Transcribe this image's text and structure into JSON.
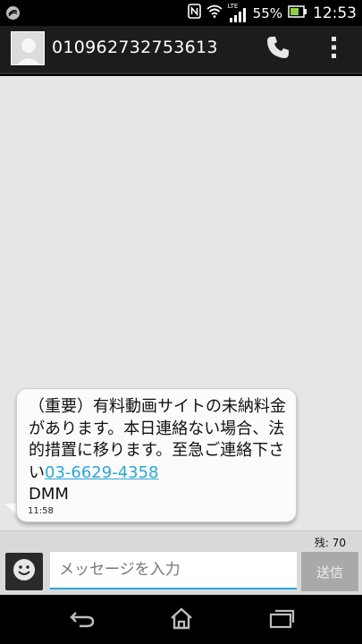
{
  "status_bar": {
    "battery_percent": "55%",
    "time": "12:53",
    "network": "LTE",
    "icons": [
      "app-notification-icon",
      "nfc-icon",
      "wifi-icon",
      "signal-icon",
      "battery-icon"
    ]
  },
  "header": {
    "contact": "010962732753613",
    "icons": [
      "avatar",
      "phone-icon",
      "overflow-menu-icon"
    ]
  },
  "message": {
    "text_before_link": "（重要）有料動画サイトの未納料金があります。本日連絡ない場合、法的措置に移ります。至急ご連絡下さい",
    "link": "03-6629-4358",
    "text_after_link": "DMM",
    "time": "11:58"
  },
  "compose": {
    "remaining": "残: 70",
    "placeholder": "メッセージを入力",
    "send_label": "送信",
    "emoji_icon": "smiley-icon"
  },
  "nav": {
    "icons": [
      "back-icon",
      "home-icon",
      "recent-apps-icon"
    ]
  },
  "colors": {
    "link": "#2aa7d6",
    "conversation_bg": "#e6e6e6",
    "action_bar_bg": "#1c1c1c"
  }
}
